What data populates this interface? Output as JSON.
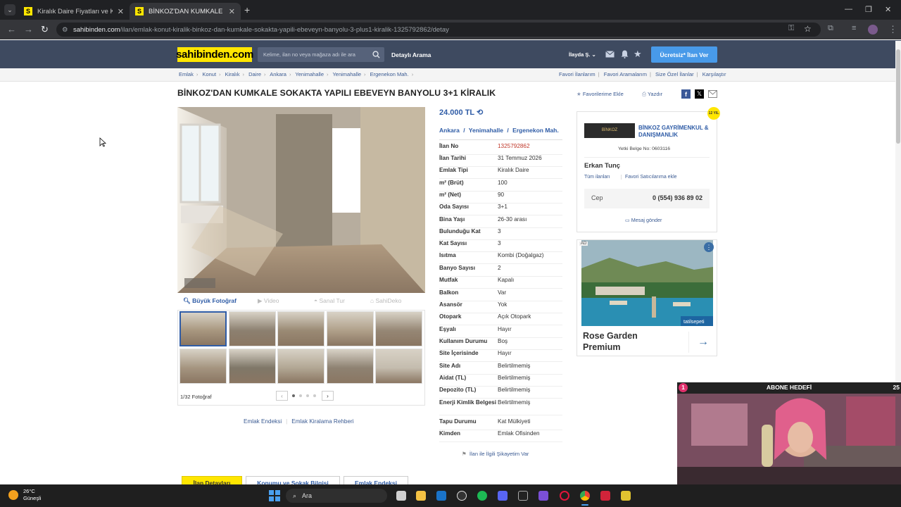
{
  "browser": {
    "tabs": [
      {
        "label": "Kiralık Daire Fiyatları ve Kiralık E"
      },
      {
        "label": "BİNKOZ'DAN KUMKALE SOKAK"
      }
    ],
    "url_host": "sahibinden.com",
    "url_path": "/ilan/emlak-konut-kiralik-binkoz-dan-kumkale-sokakta-yapili-ebeveyn-banyolu-3-plus1-kiralik-1325792862/detay"
  },
  "header": {
    "logo": "sahibinden.com",
    "search_placeholder": "Kelime, ilan no veya mağaza adı ile ara",
    "detailed_search": "Detaylı Arama",
    "user": "İlayda Ş.",
    "post_ad": "Ücretsiz* İlan Ver"
  },
  "breadcrumb": [
    "Emlak",
    "Konut",
    "Kiralık",
    "Daire",
    "Ankara",
    "Yenimahalle",
    "Yenimahalle",
    "Ergenekon Mah."
  ],
  "breadcrumb_right": [
    "Favori İlanlarım",
    "Favori Aramalarım",
    "Size Özel İlanlar",
    "Karşılaştır"
  ],
  "listing": {
    "title": "BİNKOZ'DAN KUMKALE SOKAKTA YAPILI EBEVEYN BANYOLU 3+1 KİRALIK",
    "add_fav": "Favorilerime Ekle",
    "print": "Yazdır",
    "price": "24.000 TL",
    "location": {
      "city": "Ankara",
      "district": "Yenimahalle",
      "neighborhood": "Ergenekon Mah."
    },
    "media_tabs": {
      "photo": "Büyük Fotoğraf",
      "video": "Video",
      "tour": "Sanal Tur",
      "deko": "SahiDeko"
    },
    "photo_count": "1/32 Fotoğraf",
    "links": [
      "Emlak Endeksi",
      "Emlak Kiralama Rehberi"
    ],
    "complaint": "İlan ile İlgili Şikayetim Var",
    "details": [
      {
        "k": "İlan No",
        "v": "1325792862"
      },
      {
        "k": "İlan Tarihi",
        "v": "31 Temmuz 2026"
      },
      {
        "k": "Emlak Tipi",
        "v": "Kiralık Daire"
      },
      {
        "k": "m² (Brüt)",
        "v": "100"
      },
      {
        "k": "m² (Net)",
        "v": "90"
      },
      {
        "k": "Oda Sayısı",
        "v": "3+1"
      },
      {
        "k": "Bina Yaşı",
        "v": "26-30 arası"
      },
      {
        "k": "Bulunduğu Kat",
        "v": "3"
      },
      {
        "k": "Kat Sayısı",
        "v": "3"
      },
      {
        "k": "Isıtma",
        "v": "Kombi (Doğalgaz)"
      },
      {
        "k": "Banyo Sayısı",
        "v": "2"
      },
      {
        "k": "Mutfak",
        "v": "Kapalı"
      },
      {
        "k": "Balkon",
        "v": "Var"
      },
      {
        "k": "Asansör",
        "v": "Yok"
      },
      {
        "k": "Otopark",
        "v": "Açık Otopark"
      },
      {
        "k": "Eşyalı",
        "v": "Hayır"
      },
      {
        "k": "Kullanım Durumu",
        "v": "Boş"
      },
      {
        "k": "Site İçerisinde",
        "v": "Hayır"
      },
      {
        "k": "Site Adı",
        "v": "Belirtilmemiş"
      },
      {
        "k": "Aidat (TL)",
        "v": "Belirtilmemiş"
      },
      {
        "k": "Depozito (TL)",
        "v": "Belirtilmemiş"
      },
      {
        "k": "Enerji Kimlik Belgesi",
        "v": "Belirtilmemiş"
      },
      {
        "k": "Tapu Durumu",
        "v": "Kat Mülkiyeti"
      },
      {
        "k": "Kimden",
        "v": "Emlak Ofisinden"
      }
    ],
    "bottom_tabs": [
      "İlan Detayları",
      "Konumu ve Sokak Bilgisi",
      "Emlak Endeksi"
    ]
  },
  "seller": {
    "badge": "12 YIL",
    "company": "BİNKOZ GAYRİMENKUL & DANIŞMANLIK",
    "license": "Yetki Belge No: 0603116",
    "name": "Erkan Tunç",
    "all_ads": "Tüm ilanları",
    "fav_seller": "Favori Satıcılarıma ekle",
    "phone_label": "Cep",
    "phone": "0 (554) 936 89 02",
    "message": "Mesaj gönder"
  },
  "advert": {
    "badge": "AD",
    "brand": "tatilsepeti",
    "title": "Rose Garden Premium"
  },
  "stream": {
    "counter_left": "1",
    "title": "ABONE HEDEFİ",
    "counter_right": "25"
  },
  "taskbar": {
    "temp": "26°C",
    "weather": "Güneşli",
    "search": "Ara"
  },
  "colors": {
    "brand_yellow": "#ffe600",
    "header_bg": "#3e4a60",
    "link_blue": "#2f5ca6",
    "listing_no": "#c0392b",
    "cta_blue": "#489ae9"
  }
}
